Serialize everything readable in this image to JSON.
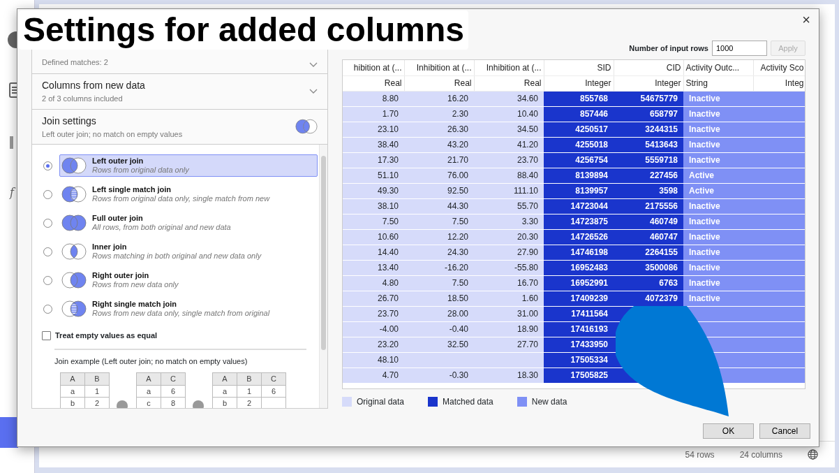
{
  "title_overlay": {
    "text": "Settings for added columns"
  },
  "dialog": {
    "close_label": "×"
  },
  "sections": [
    {
      "kind": "collapsible",
      "subtitle": "Defined matches: 2"
    },
    {
      "kind": "collapsible",
      "title": "Columns from new data",
      "subtitle": "2 of 3 columns included"
    },
    {
      "kind": "join",
      "title": "Join settings",
      "subtitle": "Left outer join; no match on empty values"
    }
  ],
  "join_options": [
    {
      "kind": "left",
      "title": "Left outer join",
      "description": "Rows from original data only",
      "selected": true
    },
    {
      "kind": "left_single",
      "title": "Left single match join",
      "description": "Rows from original data only, single match from new",
      "selected": false
    },
    {
      "kind": "full",
      "title": "Full outer join",
      "description": "All rows, from both original and new data",
      "selected": false
    },
    {
      "kind": "inner",
      "title": "Inner join",
      "description": "Rows matching in both original and new data only",
      "selected": false
    },
    {
      "kind": "right",
      "title": "Right outer join",
      "description": "Rows from new data only",
      "selected": false
    },
    {
      "kind": "right_single",
      "title": "Right single match join",
      "description": "Rows from new data only, single match from original",
      "selected": false
    }
  ],
  "treat_empty_equal": {
    "label": "Treat empty values as equal",
    "checked": false
  },
  "join_example": {
    "caption": "Join example (Left outer join; no match on empty values)",
    "tables": [
      {
        "columns": [
          "A",
          "B"
        ],
        "rows": [
          [
            "a",
            "1"
          ],
          [
            "b",
            "2"
          ]
        ]
      },
      {
        "columns": [
          "A",
          "C"
        ],
        "rows": [
          [
            "a",
            "6"
          ],
          [
            "c",
            "8"
          ]
        ]
      },
      {
        "columns": [
          "A",
          "B",
          "C"
        ],
        "rows": [
          [
            "a",
            "1",
            "6"
          ],
          [
            "b",
            "2",
            null
          ]
        ]
      }
    ]
  },
  "input_rows": {
    "label": "Number of input rows",
    "value": "1000",
    "apply": {
      "label": "Apply",
      "disabled": true
    }
  },
  "table": {
    "columns": [
      {
        "header": "hibition at (...",
        "type": "Real",
        "kind": "original",
        "numeric": true
      },
      {
        "header": "Inhibition at (...",
        "type": "Real",
        "kind": "original",
        "numeric": true
      },
      {
        "header": "Inhibition at (...",
        "type": "Real",
        "kind": "original",
        "numeric": true
      },
      {
        "header": "SID",
        "type": "Integer",
        "kind": "matched",
        "numeric": true
      },
      {
        "header": "CID",
        "type": "Integer",
        "kind": "matched",
        "numeric": true
      },
      {
        "header": "Activity Outc...",
        "type": "String",
        "kind": "new",
        "numeric": false
      },
      {
        "header": "Activity Sco",
        "type": "Integ",
        "kind": "new",
        "numeric": true
      }
    ],
    "rows": [
      [
        "8.80",
        "16.20",
        "34.60",
        "855768",
        "54675779",
        "Inactive",
        null
      ],
      [
        "1.70",
        "2.30",
        "10.40",
        "857446",
        "658797",
        "Inactive",
        null
      ],
      [
        "23.10",
        "26.30",
        "34.50",
        "4250517",
        "3244315",
        "Inactive",
        null
      ],
      [
        "38.40",
        "43.20",
        "41.20",
        "4255018",
        "5413643",
        "Inactive",
        null
      ],
      [
        "17.30",
        "21.70",
        "23.70",
        "4256754",
        "5559718",
        "Inactive",
        null
      ],
      [
        "51.10",
        "76.00",
        "88.40",
        "8139894",
        "227456",
        "Active",
        null
      ],
      [
        "49.30",
        "92.50",
        "111.10",
        "8139957",
        "3598",
        "Active",
        null
      ],
      [
        "38.10",
        "44.30",
        "55.70",
        "14723044",
        "2175556",
        "Inactive",
        null
      ],
      [
        "7.50",
        "7.50",
        "3.30",
        "14723875",
        "460749",
        "Inactive",
        null
      ],
      [
        "10.60",
        "12.20",
        "20.30",
        "14726526",
        "460747",
        "Inactive",
        null
      ],
      [
        "14.40",
        "24.30",
        "27.90",
        "14746198",
        "2264155",
        "Inactive",
        null
      ],
      [
        "13.40",
        "-16.20",
        "-55.80",
        "16952483",
        "3500086",
        "Inactive",
        null
      ],
      [
        "4.80",
        "7.50",
        "16.70",
        "16952991",
        "6763",
        "Inactive",
        null
      ],
      [
        "26.70",
        "18.50",
        "1.60",
        "17409239",
        "4072379",
        "Inactive",
        null
      ],
      [
        "23.70",
        "28.00",
        "31.00",
        "17411564",
        null,
        null,
        null
      ],
      [
        "-4.00",
        "-0.40",
        "18.90",
        "17416193",
        null,
        null,
        null
      ],
      [
        "23.20",
        "32.50",
        "27.70",
        "17433950",
        null,
        null,
        null
      ],
      [
        "48.10",
        null,
        null,
        "17505334",
        null,
        null,
        null
      ],
      [
        "4.70",
        "-0.30",
        "18.30",
        "17505825",
        null,
        null,
        null
      ]
    ]
  },
  "legend": [
    {
      "kind": "original",
      "label": "Original data",
      "color": "#d6dbfa"
    },
    {
      "kind": "matched",
      "label": "Matched data",
      "color": "#1a35cc"
    },
    {
      "kind": "new",
      "label": "New data",
      "color": "#7f90f5"
    }
  ],
  "buttons": [
    {
      "label": "OK"
    },
    {
      "label": "Cancel"
    }
  ],
  "app": {
    "sidebar_text": "f",
    "status_rows": "54 rows",
    "status_columns": "24 columns"
  }
}
